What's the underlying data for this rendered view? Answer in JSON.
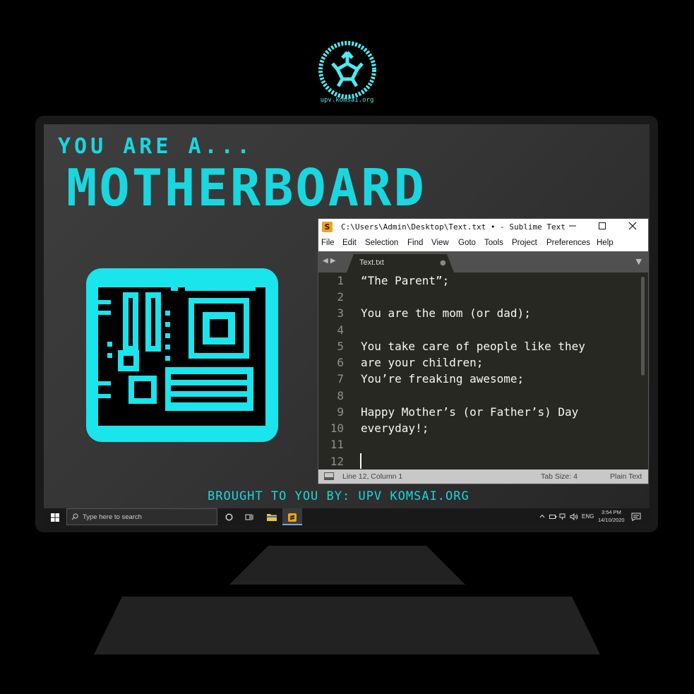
{
  "logo": {
    "url_text": "upv.komsai.org"
  },
  "poster": {
    "tagline": "YOU ARE A...",
    "headline": "MOTHERBOARD",
    "credits": "BROUGHT TO YOU BY: UPV KOMSAI.ORG"
  },
  "window": {
    "title": "C:\\Users\\Admin\\Desktop\\Text.txt  • - Sublime Text",
    "app_icon": "S",
    "minimize_icon": "minimize-icon",
    "maximize_icon": "maximize-icon",
    "close_icon": "close-icon",
    "menu": [
      "File",
      "Edit",
      "Selection",
      "Find",
      "View",
      "Goto",
      "Tools",
      "Project",
      "Preferences",
      "Help"
    ],
    "tab": {
      "label": "Text.txt",
      "modified": "●"
    },
    "tab_nav": "◀ ▶",
    "tab_dropdown": "▼",
    "lines": [
      {
        "n": "1",
        "text": "“The Parent”;"
      },
      {
        "n": "2",
        "text": ""
      },
      {
        "n": "3",
        "text": "You are the mom (or dad);"
      },
      {
        "n": "4",
        "text": ""
      },
      {
        "n": "5",
        "text": "You take care of people like they"
      },
      {
        "n": "6",
        "text": "are your children;"
      },
      {
        "n": "7",
        "text": "You’re freaking awesome;"
      },
      {
        "n": "8",
        "text": ""
      },
      {
        "n": "9",
        "text": "Happy Mother’s (or Father’s) Day"
      },
      {
        "n": "10",
        "text": "everyday!;"
      },
      {
        "n": "11",
        "text": ""
      },
      {
        "n": "12",
        "text": ""
      }
    ],
    "status": {
      "position": "Line 12, Column 1",
      "tab_size": "Tab Size: 4",
      "syntax": "Plain Text"
    }
  },
  "taskbar": {
    "search_placeholder": "Type here to search",
    "lang": "ENG",
    "time": "3:54 PM",
    "date": "14/10/2020"
  },
  "colors": {
    "accent": "#1ad6de",
    "editor_bg": "#272822",
    "sublime_icon": "#f0a21b"
  }
}
